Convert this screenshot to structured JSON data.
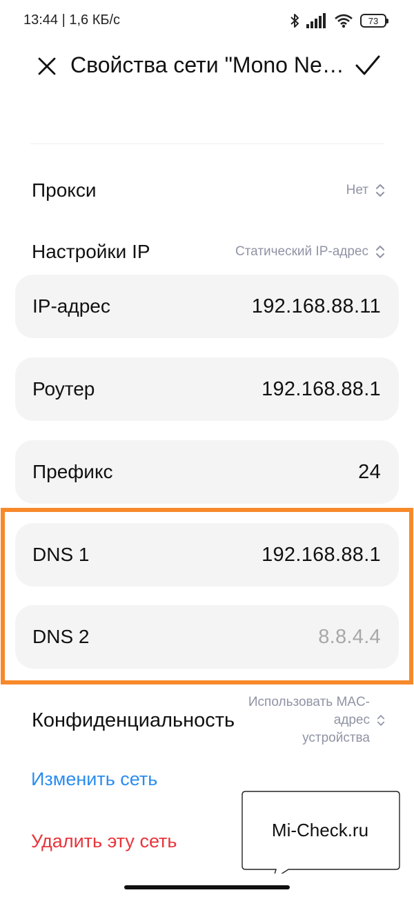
{
  "status_bar": {
    "time_speed": "13:44 | 1,6 КБ/с",
    "battery": "73",
    "icons": [
      "bluetooth-icon",
      "signal-icon",
      "wifi-icon",
      "battery-icon"
    ]
  },
  "header": {
    "title": "Свойства сети \"Mono Network\"",
    "close_icon": "close-icon",
    "confirm_icon": "check-icon"
  },
  "proxy": {
    "label": "Прокси",
    "value": "Нет"
  },
  "ip_settings": {
    "label": "Настройки IP",
    "value": "Статический IP-адрес"
  },
  "fields": [
    {
      "label": "IP-адрес",
      "value": "192.168.88.11",
      "is_placeholder": false
    },
    {
      "label": "Роутер",
      "value": "192.168.88.1",
      "is_placeholder": false
    },
    {
      "label": "Префикс",
      "value": "24",
      "is_placeholder": false
    },
    {
      "label": "DNS 1",
      "value": "192.168.88.1",
      "is_placeholder": false
    },
    {
      "label": "DNS 2",
      "value": "8.8.4.4",
      "is_placeholder": true
    }
  ],
  "privacy": {
    "label": "Конфиденциальность",
    "value_line1": "Использовать MAC-адрес",
    "value_line2": "устройства"
  },
  "actions": {
    "modify": "Изменить сеть",
    "delete": "Удалить эту сеть"
  },
  "watermark": "Mi-Check.ru",
  "colors": {
    "highlight": "#f7892a",
    "link_blue": "#2b8cf0",
    "link_red": "#e8343b",
    "card_bg": "#f4f4f4",
    "secondary_text": "#8f93a4"
  }
}
